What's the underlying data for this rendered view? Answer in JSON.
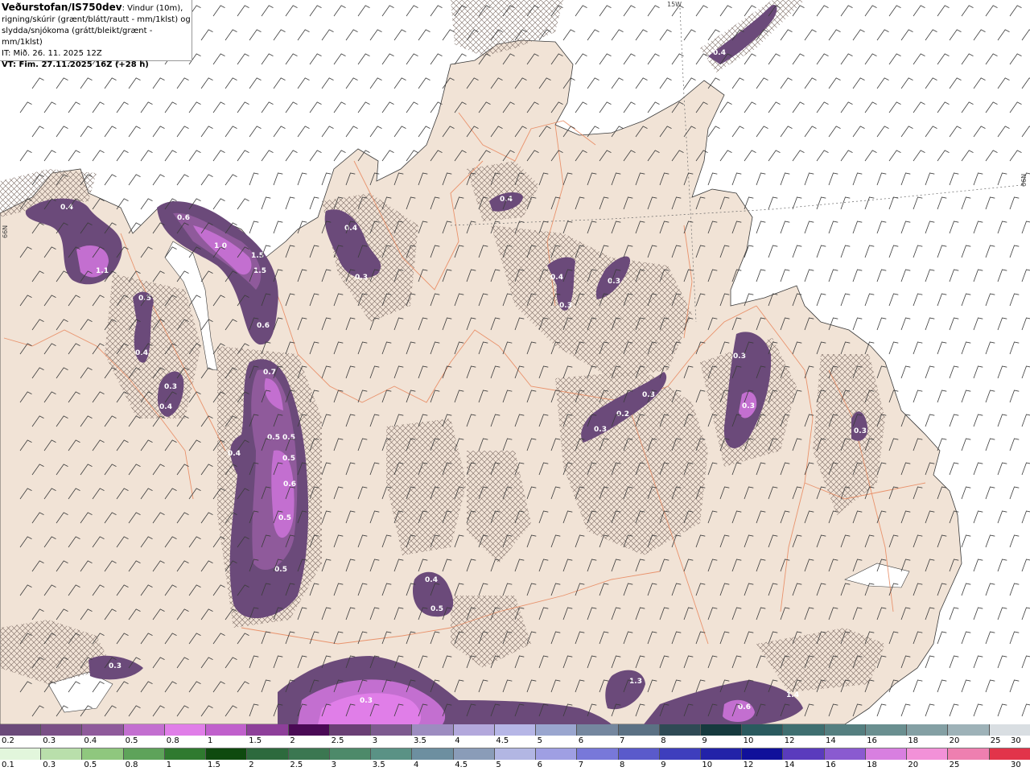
{
  "header": {
    "title": "Veðurstofan/IS750dev",
    "description_1": ": Vindur (10m),",
    "description_2": "rigning/skúrir (grænt/blátt/rautt - mm/1klst) og",
    "description_3": "slydda/snjókoma (grátt/bleikt/grænt - mm/1klst)",
    "issue_time": "IT: Mið. 26. 11. 2025 12Z",
    "valid_time": "VT: Fim. 27.11.2025 16Z (+28 h)"
  },
  "grid_labels": {
    "lon_15w": "15W",
    "lat_66n_left": "66N",
    "lat_66n_right": "66N"
  },
  "precip_labels": [
    "0.4",
    "1.1",
    "0.6",
    "1.0",
    "1.5",
    "1.5",
    "0.6",
    "0.5",
    "0.4",
    "0.3",
    "0.4",
    "0.7",
    "0.5",
    "0.5",
    "0.4",
    "0.5",
    "0.6",
    "0.5",
    "0.5",
    "0.4",
    "0.3",
    "0.4",
    "0.4",
    "0.3",
    "0.3",
    "0.3",
    "0.2",
    "0.3",
    "0.3",
    "0.3",
    "0.3",
    "0.4",
    "0.5",
    "0.3",
    "0.3",
    "1.3",
    "0.6",
    "1.4",
    "0.4"
  ],
  "legend_snow": {
    "colors": [
      "#6b4a7a",
      "#7a4f86",
      "#8f5a9b",
      "#c36fd0",
      "#e07ee8",
      "#c060cc",
      "#8e3f9a",
      "#4a0a55",
      "#6a3f75",
      "#7d5a8f",
      "#9d8cc0",
      "#b3a8dc",
      "#b6b6e6",
      "#9aa6cf",
      "#75879f",
      "#5b7184",
      "#2f4a55",
      "#163a3e",
      "#2a5a5e",
      "#3f6f70",
      "#557f80",
      "#6a8f90",
      "#84a0a4",
      "#9eb2b8",
      "#d9dee2"
    ],
    "labels": [
      "0.2",
      "0.3",
      "0.4",
      "0.5",
      "0.8",
      "1",
      "1.5",
      "2",
      "2.5",
      "3",
      "3.5",
      "4",
      "4.5",
      "5",
      "6",
      "7",
      "8",
      "9",
      "10",
      "12",
      "14",
      "16",
      "18",
      "20",
      "25",
      "30"
    ]
  },
  "legend_rain": {
    "colors": [
      "#e2f6dc",
      "#b9dfab",
      "#8fc77e",
      "#5ea35a",
      "#2f7a2f",
      "#0f4a0f",
      "#2d6a3d",
      "#3b7751",
      "#4d8a6a",
      "#5a9285",
      "#6d8fa0",
      "#8a9cb8",
      "#b2b6e3",
      "#9f9fe3",
      "#7878d9",
      "#5a5acb",
      "#3e3ebd",
      "#2222a8",
      "#10109a",
      "#5a3bbd",
      "#8a5ad0",
      "#d87fe0",
      "#f291d8",
      "#ee7fb0",
      "#e2344a"
    ],
    "labels": [
      "0.1",
      "0.3",
      "0.5",
      "0.8",
      "1",
      "1.5",
      "2",
      "2.5",
      "3",
      "3.5",
      "4",
      "4.5",
      "5",
      "6",
      "7",
      "8",
      "9",
      "10",
      "12",
      "14",
      "16",
      "18",
      "20",
      "25",
      "30"
    ]
  }
}
